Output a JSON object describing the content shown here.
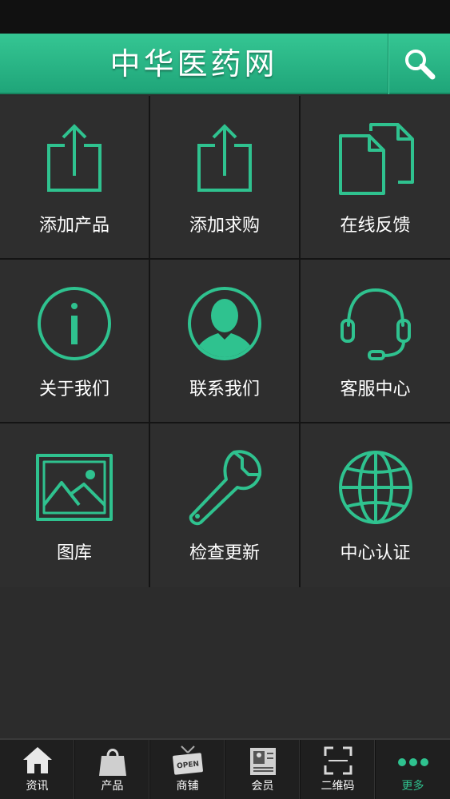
{
  "header": {
    "title": "中华医药网"
  },
  "colors": {
    "accent": "#2fc28f",
    "background": "#2e2e2e",
    "divider": "#141414"
  },
  "grid": [
    {
      "label": "添加产品",
      "icon": "share-upload-icon"
    },
    {
      "label": "添加求购",
      "icon": "share-upload-icon"
    },
    {
      "label": "在线反馈",
      "icon": "documents-icon"
    },
    {
      "label": "关于我们",
      "icon": "info-icon"
    },
    {
      "label": "联系我们",
      "icon": "user-contact-icon"
    },
    {
      "label": "客服中心",
      "icon": "headset-icon"
    },
    {
      "label": "图库",
      "icon": "picture-icon"
    },
    {
      "label": "检查更新",
      "icon": "wrench-icon"
    },
    {
      "label": "中心认证",
      "icon": "globe-icon"
    }
  ],
  "tabbar": [
    {
      "label": "资讯",
      "icon": "home-icon"
    },
    {
      "label": "产品",
      "icon": "shopping-bag-icon"
    },
    {
      "label": "商铺",
      "icon": "open-sign-icon"
    },
    {
      "label": "会员",
      "icon": "id-card-icon"
    },
    {
      "label": "二维码",
      "icon": "qr-scan-icon"
    },
    {
      "label": "更多",
      "icon": "more-dots-icon",
      "active": true
    }
  ],
  "icon_text": {
    "open_sign": "OPEN"
  }
}
